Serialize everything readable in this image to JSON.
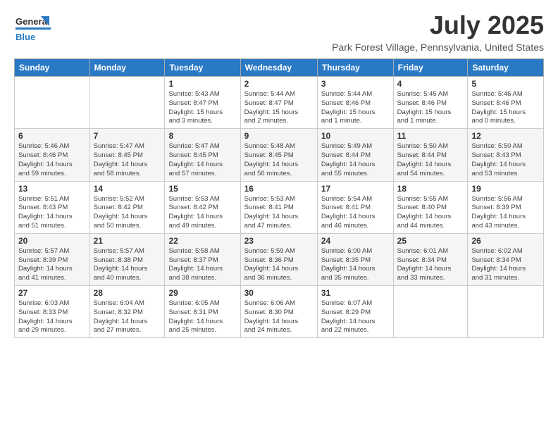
{
  "header": {
    "logo_general": "General",
    "logo_blue": "Blue",
    "title": "July 2025",
    "subtitle": "Park Forest Village, Pennsylvania, United States"
  },
  "weekdays": [
    "Sunday",
    "Monday",
    "Tuesday",
    "Wednesday",
    "Thursday",
    "Friday",
    "Saturday"
  ],
  "weeks": [
    [
      {
        "day": "",
        "info": ""
      },
      {
        "day": "",
        "info": ""
      },
      {
        "day": "1",
        "info": "Sunrise: 5:43 AM\nSunset: 8:47 PM\nDaylight: 15 hours\nand 3 minutes."
      },
      {
        "day": "2",
        "info": "Sunrise: 5:44 AM\nSunset: 8:47 PM\nDaylight: 15 hours\nand 2 minutes."
      },
      {
        "day": "3",
        "info": "Sunrise: 5:44 AM\nSunset: 8:46 PM\nDaylight: 15 hours\nand 1 minute."
      },
      {
        "day": "4",
        "info": "Sunrise: 5:45 AM\nSunset: 8:46 PM\nDaylight: 15 hours\nand 1 minute."
      },
      {
        "day": "5",
        "info": "Sunrise: 5:46 AM\nSunset: 8:46 PM\nDaylight: 15 hours\nand 0 minutes."
      }
    ],
    [
      {
        "day": "6",
        "info": "Sunrise: 5:46 AM\nSunset: 8:46 PM\nDaylight: 14 hours\nand 59 minutes."
      },
      {
        "day": "7",
        "info": "Sunrise: 5:47 AM\nSunset: 8:45 PM\nDaylight: 14 hours\nand 58 minutes."
      },
      {
        "day": "8",
        "info": "Sunrise: 5:47 AM\nSunset: 8:45 PM\nDaylight: 14 hours\nand 57 minutes."
      },
      {
        "day": "9",
        "info": "Sunrise: 5:48 AM\nSunset: 8:45 PM\nDaylight: 14 hours\nand 56 minutes."
      },
      {
        "day": "10",
        "info": "Sunrise: 5:49 AM\nSunset: 8:44 PM\nDaylight: 14 hours\nand 55 minutes."
      },
      {
        "day": "11",
        "info": "Sunrise: 5:50 AM\nSunset: 8:44 PM\nDaylight: 14 hours\nand 54 minutes."
      },
      {
        "day": "12",
        "info": "Sunrise: 5:50 AM\nSunset: 8:43 PM\nDaylight: 14 hours\nand 53 minutes."
      }
    ],
    [
      {
        "day": "13",
        "info": "Sunrise: 5:51 AM\nSunset: 8:43 PM\nDaylight: 14 hours\nand 51 minutes."
      },
      {
        "day": "14",
        "info": "Sunrise: 5:52 AM\nSunset: 8:42 PM\nDaylight: 14 hours\nand 50 minutes."
      },
      {
        "day": "15",
        "info": "Sunrise: 5:53 AM\nSunset: 8:42 PM\nDaylight: 14 hours\nand 49 minutes."
      },
      {
        "day": "16",
        "info": "Sunrise: 5:53 AM\nSunset: 8:41 PM\nDaylight: 14 hours\nand 47 minutes."
      },
      {
        "day": "17",
        "info": "Sunrise: 5:54 AM\nSunset: 8:41 PM\nDaylight: 14 hours\nand 46 minutes."
      },
      {
        "day": "18",
        "info": "Sunrise: 5:55 AM\nSunset: 8:40 PM\nDaylight: 14 hours\nand 44 minutes."
      },
      {
        "day": "19",
        "info": "Sunrise: 5:56 AM\nSunset: 8:39 PM\nDaylight: 14 hours\nand 43 minutes."
      }
    ],
    [
      {
        "day": "20",
        "info": "Sunrise: 5:57 AM\nSunset: 8:39 PM\nDaylight: 14 hours\nand 41 minutes."
      },
      {
        "day": "21",
        "info": "Sunrise: 5:57 AM\nSunset: 8:38 PM\nDaylight: 14 hours\nand 40 minutes."
      },
      {
        "day": "22",
        "info": "Sunrise: 5:58 AM\nSunset: 8:37 PM\nDaylight: 14 hours\nand 38 minutes."
      },
      {
        "day": "23",
        "info": "Sunrise: 5:59 AM\nSunset: 8:36 PM\nDaylight: 14 hours\nand 36 minutes."
      },
      {
        "day": "24",
        "info": "Sunrise: 6:00 AM\nSunset: 8:35 PM\nDaylight: 14 hours\nand 35 minutes."
      },
      {
        "day": "25",
        "info": "Sunrise: 6:01 AM\nSunset: 8:34 PM\nDaylight: 14 hours\nand 33 minutes."
      },
      {
        "day": "26",
        "info": "Sunrise: 6:02 AM\nSunset: 8:34 PM\nDaylight: 14 hours\nand 31 minutes."
      }
    ],
    [
      {
        "day": "27",
        "info": "Sunrise: 6:03 AM\nSunset: 8:33 PM\nDaylight: 14 hours\nand 29 minutes."
      },
      {
        "day": "28",
        "info": "Sunrise: 6:04 AM\nSunset: 8:32 PM\nDaylight: 14 hours\nand 27 minutes."
      },
      {
        "day": "29",
        "info": "Sunrise: 6:05 AM\nSunset: 8:31 PM\nDaylight: 14 hours\nand 25 minutes."
      },
      {
        "day": "30",
        "info": "Sunrise: 6:06 AM\nSunset: 8:30 PM\nDaylight: 14 hours\nand 24 minutes."
      },
      {
        "day": "31",
        "info": "Sunrise: 6:07 AM\nSunset: 8:29 PM\nDaylight: 14 hours\nand 22 minutes."
      },
      {
        "day": "",
        "info": ""
      },
      {
        "day": "",
        "info": ""
      }
    ]
  ]
}
